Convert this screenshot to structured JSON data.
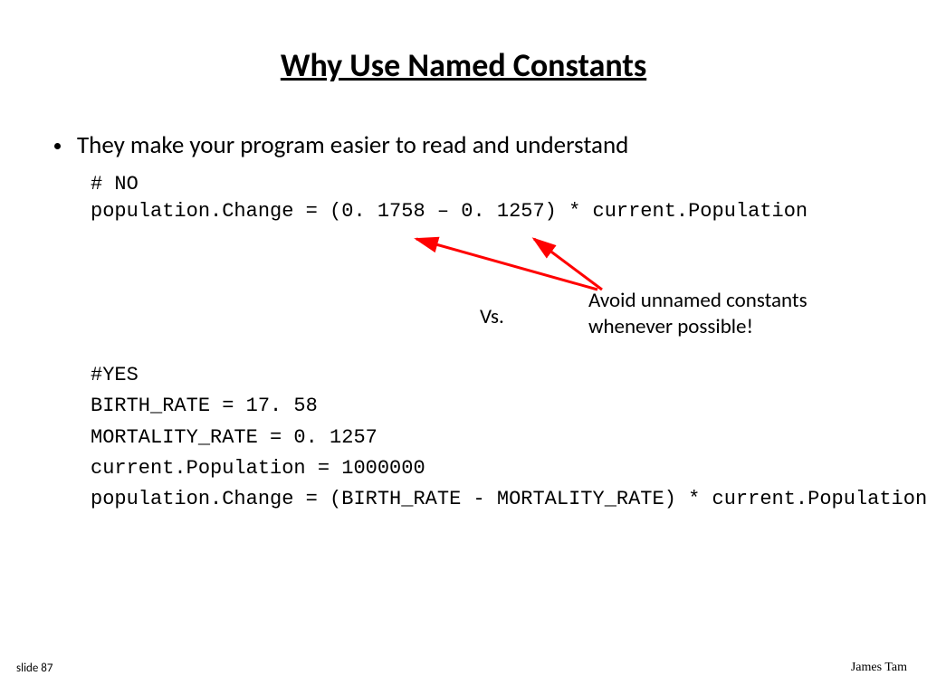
{
  "title": "Why Use Named Constants",
  "bullet": "They make your program easier to read and understand",
  "no_block": {
    "line1": "# NO",
    "line2": "population.Change = (0. 1758 – 0. 1257) * current.Population"
  },
  "vs_label": "Vs.",
  "callout": {
    "line1": "Avoid unnamed constants",
    "line2": "whenever possible!"
  },
  "yes_block": {
    "line1": "#YES",
    "line2": "BIRTH_RATE = 17. 58",
    "line3": "MORTALITY_RATE = 0. 1257",
    "line4": "current.Population = 1000000",
    "line5": "population.Change = (BIRTH_RATE - MORTALITY_RATE) * current.Population"
  },
  "footer_left": "slide 87",
  "footer_right": "James Tam"
}
